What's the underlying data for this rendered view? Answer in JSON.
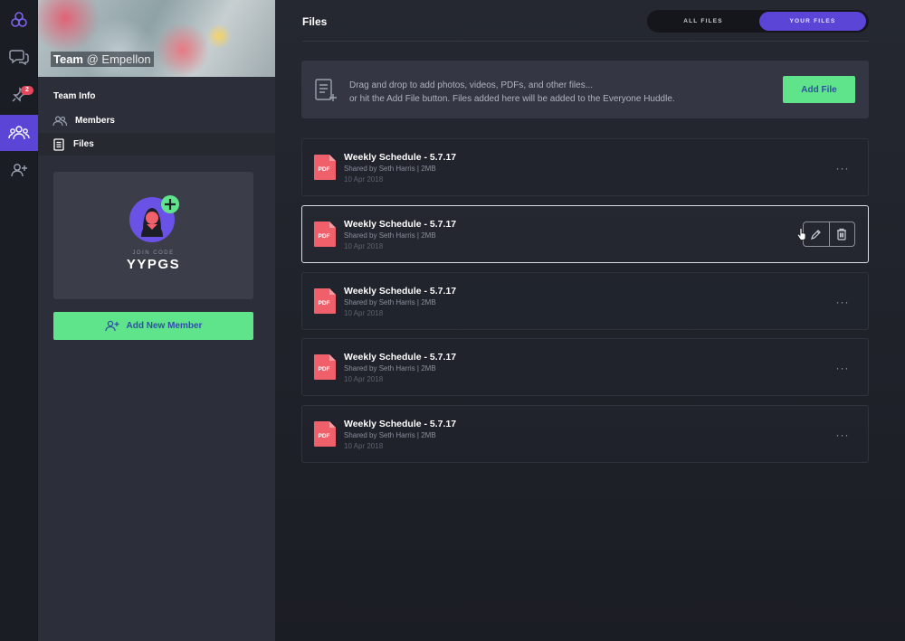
{
  "rail": {
    "items": [
      {
        "icon": "app-logo-icon"
      },
      {
        "icon": "chat-icon"
      },
      {
        "icon": "pin-icon",
        "badge": "2"
      },
      {
        "icon": "team-icon",
        "active": true
      },
      {
        "icon": "add-person-icon"
      }
    ]
  },
  "team": {
    "name": "Team",
    "org": "@ Empellon",
    "section_title": "Team Info",
    "nav": [
      {
        "label": "Members",
        "icon": "members-icon"
      },
      {
        "label": "Files",
        "icon": "document-icon",
        "active": true
      }
    ],
    "join_label": "JOIN CODE",
    "join_code": "YYPGS",
    "add_member_label": "Add New Member"
  },
  "main": {
    "title": "Files",
    "toggle": {
      "all": "ALL FILES",
      "yours": "YOUR FILES",
      "selected": "YOUR FILES"
    },
    "dropzone": {
      "line1": "Drag and drop to add photos, videos, PDFs, and other files...",
      "line2": "or hit the Add File button. Files added here will be added to the Everyone Huddle.",
      "button": "Add File"
    },
    "files": [
      {
        "name": "Weekly Schedule - 5.7.17",
        "meta": "Shared by Seth Harris  |  2MB",
        "date": "10 Apr 2018",
        "type": "PDF"
      },
      {
        "name": "Weekly Schedule - 5.7.17",
        "meta": "Shared by Seth Harris  |  2MB",
        "date": "10 Apr 2018",
        "type": "PDF",
        "selected": true
      },
      {
        "name": "Weekly Schedule - 5.7.17",
        "meta": "Shared by Seth Harris  |  2MB",
        "date": "10 Apr 2018",
        "type": "PDF"
      },
      {
        "name": "Weekly Schedule - 5.7.17",
        "meta": "Shared by Seth Harris  |  2MB",
        "date": "10 Apr 2018",
        "type": "PDF"
      },
      {
        "name": "Weekly Schedule - 5.7.17",
        "meta": "Shared by Seth Harris  |  2MB",
        "date": "10 Apr 2018",
        "type": "PDF"
      }
    ],
    "more_label": "···"
  },
  "colors": {
    "accent": "#5b45d6",
    "green": "#5fe38b",
    "pdf_red": "#f0606b",
    "badge_red": "#e5485b"
  }
}
